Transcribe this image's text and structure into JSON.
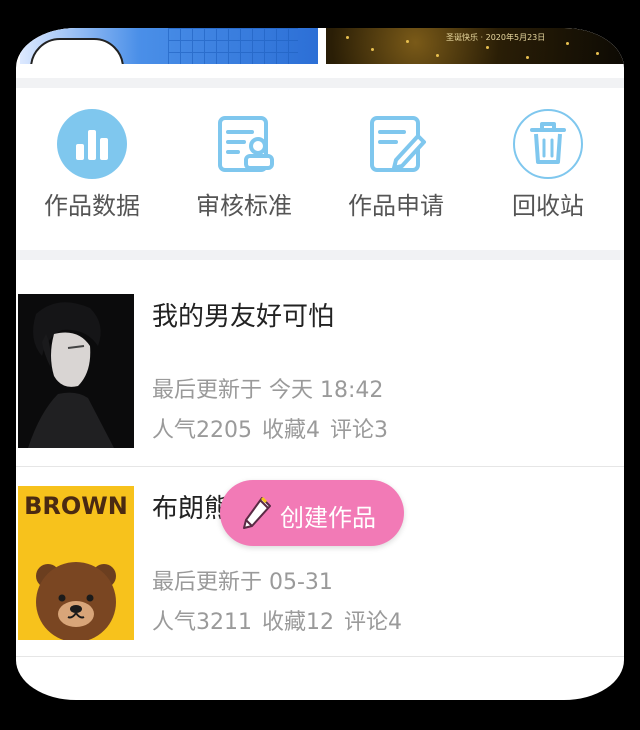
{
  "banner": {
    "right_caption": "圣诞快乐 · 2020年5月23日"
  },
  "menu": {
    "items": [
      {
        "label": "作品数据",
        "icon": "bar-chart-icon"
      },
      {
        "label": "审核标准",
        "icon": "document-person-icon"
      },
      {
        "label": "作品申请",
        "icon": "edit-document-icon"
      },
      {
        "label": "回收站",
        "icon": "trash-icon"
      }
    ]
  },
  "works": [
    {
      "title": "我的男友好可怕",
      "updated": "最后更新于 今天 18:42",
      "popularity": "人气2205",
      "favorites": "收藏4",
      "comments": "评论3"
    },
    {
      "title": "布朗熊",
      "updated": "最后更新于 05-31",
      "popularity": "人气3211",
      "favorites": "收藏12",
      "comments": "评论4",
      "cover_text": "BROWN"
    }
  ],
  "fab": {
    "label": "创建作品",
    "icon": "pencil-icon"
  },
  "colors": {
    "accent_blue": "#7fc7ee",
    "fab_pink": "#f27ab6",
    "cover_yellow": "#f7c21c"
  }
}
